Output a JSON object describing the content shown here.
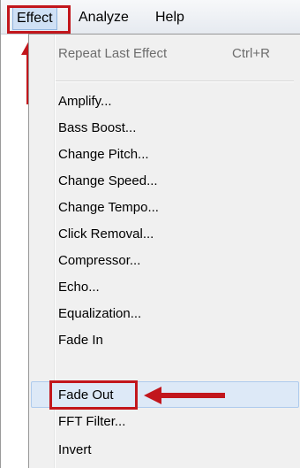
{
  "menubar": {
    "items": [
      {
        "label": "Effect",
        "active": true
      },
      {
        "label": "Analyze"
      },
      {
        "label": "Help"
      }
    ]
  },
  "dropdown": {
    "repeat": {
      "label": "Repeat Last Effect",
      "shortcut": "Ctrl+R",
      "disabled": true
    },
    "items": [
      "Amplify...",
      "Bass Boost...",
      "Change Pitch...",
      "Change Speed...",
      "Change Tempo...",
      "Click Removal...",
      "Compressor...",
      "Echo...",
      "Equalization...",
      "Fade In",
      "Fade Out",
      "FFT Filter...",
      "Invert"
    ],
    "highlighted_item": "Fade Out"
  },
  "colors": {
    "annotation": "#c2161c",
    "highlight": "#dde9f7"
  },
  "annotations": {
    "arrow_icon": "red-arrow-icon"
  }
}
